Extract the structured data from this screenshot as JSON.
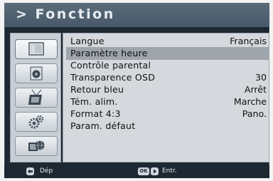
{
  "header": {
    "title": "> Fonction"
  },
  "sidebar": {
    "items": [
      {
        "icon": "tv-screen-icon",
        "active": true
      },
      {
        "icon": "speaker-icon",
        "active": false
      },
      {
        "icon": "antenna-icon",
        "active": false
      },
      {
        "icon": "gears-icon",
        "active": false
      },
      {
        "icon": "tv-globe-icon",
        "active": false
      }
    ]
  },
  "menu": {
    "items": [
      {
        "label": "Langue",
        "value": "Français",
        "selected": false
      },
      {
        "label": "Paramètre heure",
        "value": "",
        "selected": true
      },
      {
        "label": "Contrôle parental",
        "value": "",
        "selected": false
      },
      {
        "label": "Transparence OSD",
        "value": "30",
        "selected": false
      },
      {
        "label": "Retour bleu",
        "value": "Arrêt",
        "selected": false
      },
      {
        "label": "Tém. alim.",
        "value": "Marche",
        "selected": false
      },
      {
        "label": "Format 4:3",
        "value": "Pano.",
        "selected": false
      },
      {
        "label": "Param. défaut",
        "value": "",
        "selected": false
      }
    ]
  },
  "footer": {
    "back_label": "Dép",
    "ok_key": "OK",
    "enter_label": "Entr."
  },
  "colors": {
    "frame": "#1d2833",
    "header": "#52636f",
    "selected_row": "#9ea5ab",
    "panel": "#d5d9dd"
  }
}
